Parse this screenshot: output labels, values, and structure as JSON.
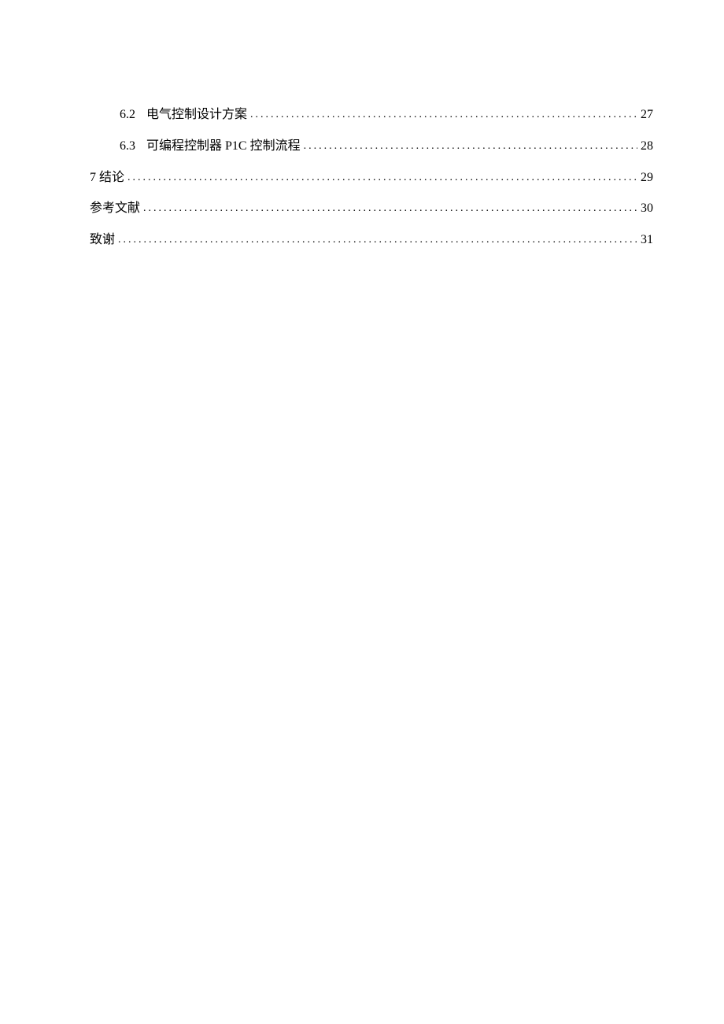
{
  "toc": {
    "entries": [
      {
        "level": 2,
        "number": "6.2",
        "title": "电气控制设计方案",
        "page": "27"
      },
      {
        "level": 2,
        "number": "6.3",
        "title": "可编程控制器 P1C 控制流程",
        "page": "28"
      },
      {
        "level": 1,
        "number": "",
        "title": "7 结论",
        "page": "29"
      },
      {
        "level": 1,
        "number": "",
        "title": "参考文献",
        "page": "30"
      },
      {
        "level": 1,
        "number": "",
        "title": "致谢",
        "page": "31"
      }
    ]
  }
}
